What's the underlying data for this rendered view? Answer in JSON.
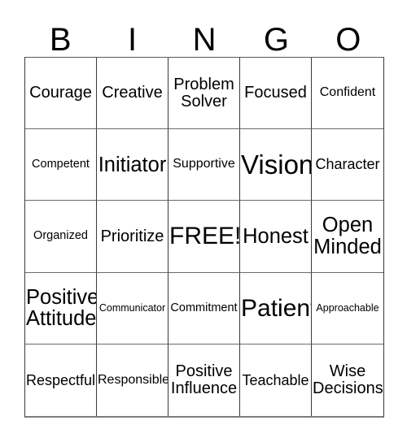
{
  "card": {
    "title": "BINGO",
    "header_letters": [
      "B",
      "I",
      "N",
      "G",
      "O"
    ],
    "free_space_label": "FREE!",
    "grid_size": "5x5",
    "colors": {
      "background": "#ffffff",
      "text": "#000000",
      "grid_line": "#3a3a3a",
      "outer_border": "#7d7d7d"
    },
    "cells": [
      {
        "text": "Courage",
        "size": "ml",
        "lines": 1
      },
      {
        "text": "Creative",
        "size": "ml",
        "lines": 1
      },
      {
        "text": "Problem\nSolver",
        "size": "ml",
        "lines": 2
      },
      {
        "text": "Focused",
        "size": "ml",
        "lines": 1
      },
      {
        "text": "Confident",
        "size": "s",
        "lines": 1
      },
      {
        "text": "Competent",
        "size": "xs",
        "lines": 1
      },
      {
        "text": "Initiator",
        "size": "xl",
        "lines": 1
      },
      {
        "text": "Supportive",
        "size": "s",
        "lines": 1
      },
      {
        "text": "Vision",
        "size": "max",
        "lines": 1
      },
      {
        "text": "Character",
        "size": "m",
        "lines": 1
      },
      {
        "text": "Organized",
        "size": "xs",
        "lines": 1
      },
      {
        "text": "Prioritize",
        "size": "ml",
        "lines": 1
      },
      {
        "text": "FREE!",
        "size": "xxl",
        "lines": 1
      },
      {
        "text": "Honest",
        "size": "xl",
        "lines": 1
      },
      {
        "text": "Open\nMinded",
        "size": "xl",
        "lines": 2
      },
      {
        "text": "Positive\nAttitude",
        "size": "xl",
        "lines": 2
      },
      {
        "text": "Communicator",
        "size": "xxs",
        "lines": 1
      },
      {
        "text": "Commitment",
        "size": "xs",
        "lines": 1
      },
      {
        "text": "Patient",
        "size": "xxl",
        "lines": 1
      },
      {
        "text": "Approachable",
        "size": "xxs",
        "lines": 1
      },
      {
        "text": "Respectful",
        "size": "m",
        "lines": 1
      },
      {
        "text": "Responsible",
        "size": "s",
        "lines": 1
      },
      {
        "text": "Positive\nInfluence",
        "size": "ml",
        "lines": 2
      },
      {
        "text": "Teachable",
        "size": "m",
        "lines": 1
      },
      {
        "text": "Wise\nDecisions",
        "size": "ml",
        "lines": 2
      }
    ]
  }
}
